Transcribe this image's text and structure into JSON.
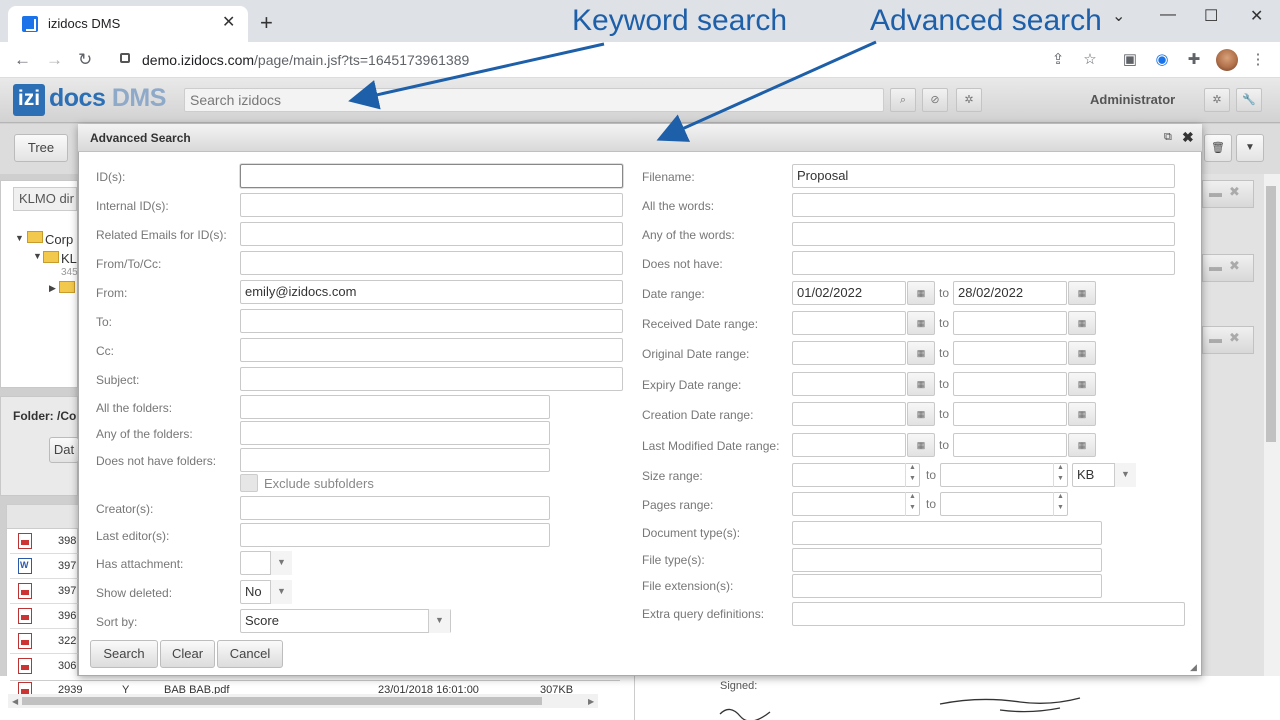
{
  "browser": {
    "tab_title": "izidocs DMS",
    "url_host": "demo.izidocs.com",
    "url_path": "/page/main.jsf?ts=1645173961389"
  },
  "app": {
    "logo_badge": "izi",
    "logo_docs": "docs",
    "logo_dms": "DMS",
    "search_placeholder": "Search izidocs",
    "user": "Administrator",
    "tree_button": "Tree",
    "klmo_label": "KLMO dir",
    "tree_root": "Corp",
    "tree_child": "KL",
    "tree_count": "345",
    "folder_label": "Folder: /Co",
    "dat_button": "Dat",
    "grid_ids": [
      "398",
      "397",
      "397",
      "396",
      "322",
      "306",
      "2939"
    ],
    "bottom_row": {
      "flag": "Y",
      "file": "BAB BAB.pdf",
      "date": "23/01/2018 16:01:00",
      "size": "307KB"
    },
    "signed_label": "Signed:"
  },
  "dialog": {
    "title": "Advanced Search",
    "left_fields": [
      {
        "label": "ID(s):",
        "value": ""
      },
      {
        "label": "Internal ID(s):",
        "value": ""
      },
      {
        "label": "Related Emails for ID(s):",
        "value": ""
      },
      {
        "label": "From/To/Cc:",
        "value": ""
      },
      {
        "label": "From:",
        "value": "emily@izidocs.com"
      },
      {
        "label": "To:",
        "value": ""
      },
      {
        "label": "Cc:",
        "value": ""
      },
      {
        "label": "Subject:",
        "value": ""
      },
      {
        "label": "All the folders:",
        "value": ""
      },
      {
        "label": "Any of the folders:",
        "value": ""
      },
      {
        "label": "Does not have folders:",
        "value": ""
      },
      {
        "label": "Creator(s):",
        "value": ""
      },
      {
        "label": "Last editor(s):",
        "value": ""
      },
      {
        "label": "Has attachment:",
        "value": ""
      },
      {
        "label": "Show deleted:",
        "value": "No"
      },
      {
        "label": "Sort by:",
        "value": "Score"
      }
    ],
    "exclude_subfolders": "Exclude subfolders",
    "right_fields": [
      {
        "label": "Filename:",
        "value": "Proposal"
      },
      {
        "label": "All the words:",
        "value": ""
      },
      {
        "label": "Any of the words:",
        "value": ""
      },
      {
        "label": "Does not have:",
        "value": ""
      }
    ],
    "date_ranges": [
      {
        "label": "Date range:",
        "from": "01/02/2022",
        "to": "28/02/2022"
      },
      {
        "label": "Received Date range:",
        "from": "",
        "to": ""
      },
      {
        "label": "Original Date range:",
        "from": "",
        "to": ""
      },
      {
        "label": "Expiry Date range:",
        "from": "",
        "to": ""
      },
      {
        "label": "Creation Date range:",
        "from": "",
        "to": ""
      },
      {
        "label": "Last Modified Date range:",
        "from": "",
        "to": ""
      }
    ],
    "to_word": "to",
    "size_range_label": "Size range:",
    "size_unit": "KB",
    "pages_range_label": "Pages range:",
    "doc_type_label": "Document type(s):",
    "file_type_label": "File type(s):",
    "file_ext_label": "File extension(s):",
    "extra_query_label": "Extra query definitions:",
    "buttons": {
      "search": "Search",
      "clear": "Clear",
      "cancel": "Cancel"
    }
  },
  "annotations": {
    "keyword": "Keyword search",
    "advanced": "Advanced search",
    "color": "#1d5fa8"
  }
}
